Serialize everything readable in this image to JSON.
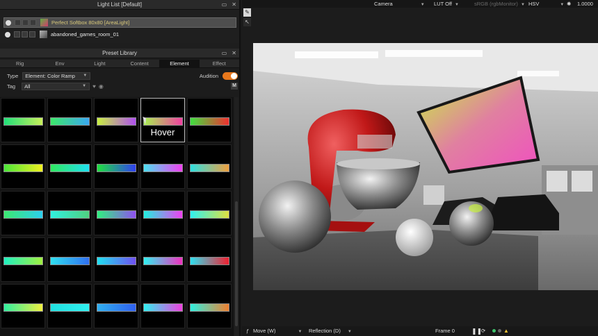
{
  "light_list": {
    "title": "Light List [Default]",
    "rows": [
      {
        "name": "Perfect Softbox 80x80 [AreaLight]",
        "selected": true,
        "thumb_color": "#5fae44"
      },
      {
        "name": "abandoned_games_room_01",
        "selected": false,
        "thumb_color": "#8a8a8a"
      }
    ]
  },
  "preset_library": {
    "title": "Preset Library",
    "tabs": [
      "Rig",
      "Env",
      "Light",
      "Content",
      "Element",
      "Effect"
    ],
    "active_tab": "Element",
    "type_label": "Type",
    "type_value": "Element: Color Ramp",
    "audition_label": "Audition",
    "tag_label": "Tag",
    "tag_value": "All",
    "m_button": "M",
    "hover_text": "Hover",
    "ramps": [
      [
        "linear-gradient(90deg,#21e07a,#c8f05a)",
        "linear-gradient(90deg,#3de86a,#3aa8f0)",
        "linear-gradient(90deg,#c8f040,#b050f0)",
        "linear-gradient(90deg,#a8f050,#f040a0)",
        "linear-gradient(90deg,#40e040,#f03030)"
      ],
      [
        "linear-gradient(90deg,#4ce83a,#f0f020)",
        "linear-gradient(90deg,#30e860,#20e0f0)",
        "linear-gradient(90deg,#20e040,#3040f0)",
        "linear-gradient(90deg,#4ce0f0,#f040f0)",
        "linear-gradient(90deg,#30e0e0,#f0a040)"
      ],
      [
        "linear-gradient(90deg,#3ce870,#2cd0f0)",
        "linear-gradient(90deg,#30f0e0,#50d080)",
        "linear-gradient(90deg,#30f080,#9050f0)",
        "linear-gradient(90deg,#20f0e0,#f040f0)",
        "linear-gradient(90deg,#30f0f0,#e0e040)"
      ],
      [
        "linear-gradient(90deg,#20f0c0,#a0f040)",
        "linear-gradient(90deg,#30e0f0,#3070f0)",
        "linear-gradient(90deg,#20e0f0,#7050f0)",
        "linear-gradient(90deg,#30f0f0,#f030c0)",
        "linear-gradient(90deg,#30e0f0,#f02030)"
      ],
      [
        "linear-gradient(90deg,#30f0a0,#f0f040)",
        "linear-gradient(90deg,#20e0e0,#30f0f0)",
        "linear-gradient(90deg,#30b0f0,#3060f0)",
        "linear-gradient(90deg,#30f0f0,#f040e0)",
        "linear-gradient(90deg,#30f0e0,#f08030)"
      ]
    ],
    "hover_cell": [
      0,
      3
    ]
  },
  "viewer": {
    "camera_label": "Camera",
    "lut_label": "LUT Off",
    "colorspace_label": "sRGB (rgbMonitor)",
    "mode_label": "HSV",
    "value_label": "1.0000",
    "move_label": "Move (W)",
    "reflection_label": "Reflection (D)",
    "frame_label": "Frame 0"
  },
  "colors": {
    "accent": "#e8781c",
    "status_ok": "#3cc26a",
    "warning": "#f2c232"
  }
}
